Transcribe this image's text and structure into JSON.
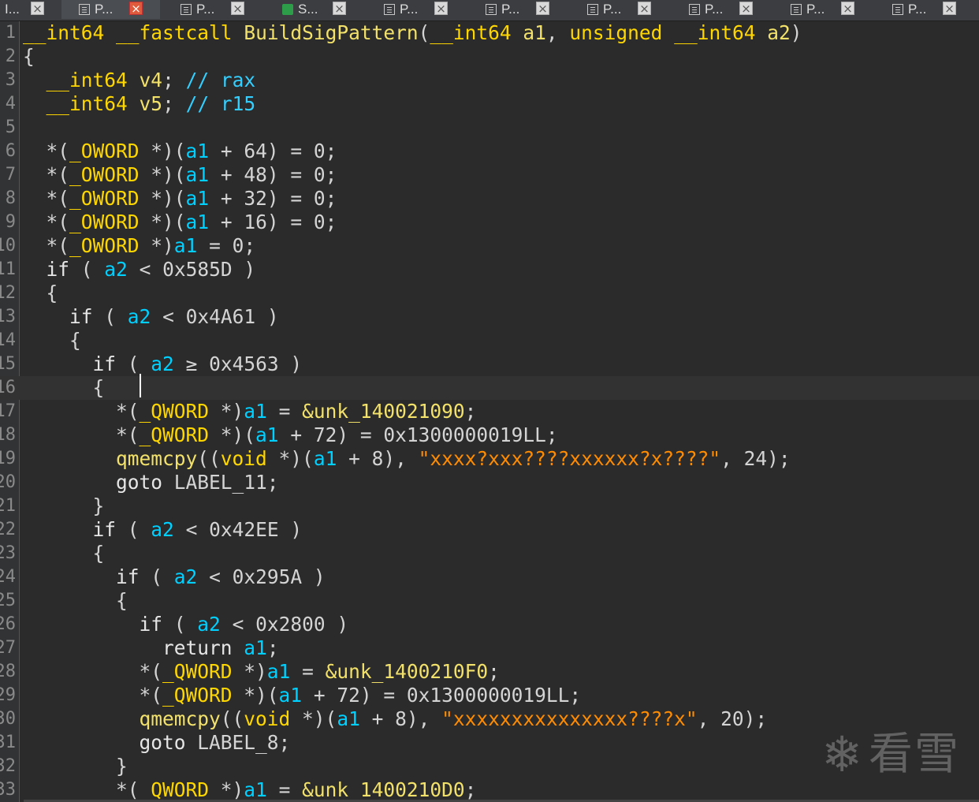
{
  "tabs": [
    {
      "label": "I...",
      "icon": "none",
      "active": false
    },
    {
      "label": "P...",
      "icon": "pseudocode-icon",
      "active": true
    },
    {
      "label": "P...",
      "icon": "pseudocode-icon",
      "active": false
    },
    {
      "label": "S...",
      "icon": "structures-icon",
      "active": false
    },
    {
      "label": "P...",
      "icon": "pseudocode-icon",
      "active": false
    },
    {
      "label": "P...",
      "icon": "pseudocode-icon",
      "active": false
    },
    {
      "label": "P...",
      "icon": "pseudocode-icon",
      "active": false
    },
    {
      "label": "P...",
      "icon": "pseudocode-icon",
      "active": false
    },
    {
      "label": "P...",
      "icon": "pseudocode-icon",
      "active": false
    },
    {
      "label": "P...",
      "icon": "pseudocode-icon",
      "active": false
    }
  ],
  "close_glyph": "×",
  "lines": [
    {
      "n": "1",
      "t": [
        [
          "ty",
          "__int64"
        ],
        [
          "pn",
          " "
        ],
        [
          "ty",
          "__fastcall"
        ],
        [
          "pn",
          " "
        ],
        [
          "fn",
          "BuildSigPattern"
        ],
        [
          "pn",
          "("
        ],
        [
          "ty",
          "__int64"
        ],
        [
          "pn",
          " "
        ],
        [
          "fn",
          "a1"
        ],
        [
          "pn",
          ", "
        ],
        [
          "ty",
          "unsigned"
        ],
        [
          "pn",
          " "
        ],
        [
          "ty",
          "__int64"
        ],
        [
          "pn",
          " "
        ],
        [
          "fn",
          "a2"
        ],
        [
          "pn",
          ")"
        ]
      ]
    },
    {
      "n": "2",
      "t": [
        [
          "pn",
          "{"
        ]
      ]
    },
    {
      "n": "3",
      "t": [
        [
          "pn",
          "  "
        ],
        [
          "ty",
          "__int64"
        ],
        [
          "pn",
          " "
        ],
        [
          "fn",
          "v4"
        ],
        [
          "pn",
          "; "
        ],
        [
          "cm",
          "// rax"
        ]
      ]
    },
    {
      "n": "4",
      "t": [
        [
          "pn",
          "  "
        ],
        [
          "ty",
          "__int64"
        ],
        [
          "pn",
          " "
        ],
        [
          "fn",
          "v5"
        ],
        [
          "pn",
          "; "
        ],
        [
          "cm",
          "// r15"
        ]
      ]
    },
    {
      "n": "5",
      "t": []
    },
    {
      "n": "6",
      "t": [
        [
          "pn",
          "  *("
        ],
        [
          "ty",
          "_OWORD"
        ],
        [
          "pn",
          " *)("
        ],
        [
          "vr",
          "a1"
        ],
        [
          "pn",
          " + 64) = 0;"
        ]
      ]
    },
    {
      "n": "7",
      "t": [
        [
          "pn",
          "  *("
        ],
        [
          "ty",
          "_OWORD"
        ],
        [
          "pn",
          " *)("
        ],
        [
          "vr",
          "a1"
        ],
        [
          "pn",
          " + 48) = 0;"
        ]
      ]
    },
    {
      "n": "8",
      "t": [
        [
          "pn",
          "  *("
        ],
        [
          "ty",
          "_OWORD"
        ],
        [
          "pn",
          " *)("
        ],
        [
          "vr",
          "a1"
        ],
        [
          "pn",
          " + 32) = 0;"
        ]
      ]
    },
    {
      "n": "9",
      "t": [
        [
          "pn",
          "  *("
        ],
        [
          "ty",
          "_OWORD"
        ],
        [
          "pn",
          " *)("
        ],
        [
          "vr",
          "a1"
        ],
        [
          "pn",
          " + 16) = 0;"
        ]
      ]
    },
    {
      "n": "10",
      "t": [
        [
          "pn",
          "  *("
        ],
        [
          "ty",
          "_OWORD"
        ],
        [
          "pn",
          " *)"
        ],
        [
          "vr",
          "a1"
        ],
        [
          "pn",
          " = 0;"
        ]
      ]
    },
    {
      "n": "11",
      "t": [
        [
          "pn",
          "  "
        ],
        [
          "kw",
          "if"
        ],
        [
          "pn",
          " ( "
        ],
        [
          "vr",
          "a2"
        ],
        [
          "pn",
          " < 0x585D )"
        ]
      ]
    },
    {
      "n": "12",
      "t": [
        [
          "pn",
          "  {"
        ]
      ]
    },
    {
      "n": "13",
      "t": [
        [
          "pn",
          "    "
        ],
        [
          "kw",
          "if"
        ],
        [
          "pn",
          " ( "
        ],
        [
          "vr",
          "a2"
        ],
        [
          "pn",
          " < 0x4A61 )"
        ]
      ]
    },
    {
      "n": "14",
      "t": [
        [
          "pn",
          "    {"
        ]
      ]
    },
    {
      "n": "15",
      "t": [
        [
          "pn",
          "      "
        ],
        [
          "kw",
          "if"
        ],
        [
          "pn",
          " ( "
        ],
        [
          "vr",
          "a2"
        ],
        [
          "pn",
          " ≥ 0x4563 )"
        ]
      ]
    },
    {
      "n": "16",
      "t": [
        [
          "pn",
          "      {"
        ]
      ],
      "current": true
    },
    {
      "n": "17",
      "t": [
        [
          "pn",
          "        *("
        ],
        [
          "ty",
          "_QWORD"
        ],
        [
          "pn",
          " *)"
        ],
        [
          "vr",
          "a1"
        ],
        [
          "pn",
          " = "
        ],
        [
          "fn",
          "&unk_140021090"
        ],
        [
          "pn",
          ";"
        ]
      ]
    },
    {
      "n": "18",
      "t": [
        [
          "pn",
          "        *("
        ],
        [
          "ty",
          "_QWORD"
        ],
        [
          "pn",
          " *)("
        ],
        [
          "vr",
          "a1"
        ],
        [
          "pn",
          " + 72) = 0x1300000019LL;"
        ]
      ]
    },
    {
      "n": "19",
      "t": [
        [
          "fn",
          "        qmemcpy"
        ],
        [
          "pn",
          "(("
        ],
        [
          "ty",
          "void"
        ],
        [
          "pn",
          " *)("
        ],
        [
          "vr",
          "a1"
        ],
        [
          "pn",
          " + 8), "
        ],
        [
          "st",
          "\"xxxx?xxx????xxxxxx?x????\""
        ],
        [
          "pn",
          ", 24);"
        ]
      ]
    },
    {
      "n": "20",
      "t": [
        [
          "pn",
          "        "
        ],
        [
          "kw",
          "goto"
        ],
        [
          "pn",
          " LABEL_11;"
        ]
      ]
    },
    {
      "n": "21",
      "t": [
        [
          "pn",
          "      }"
        ]
      ]
    },
    {
      "n": "22",
      "t": [
        [
          "pn",
          "      "
        ],
        [
          "kw",
          "if"
        ],
        [
          "pn",
          " ( "
        ],
        [
          "vr",
          "a2"
        ],
        [
          "pn",
          " < 0x42EE )"
        ]
      ]
    },
    {
      "n": "23",
      "t": [
        [
          "pn",
          "      {"
        ]
      ]
    },
    {
      "n": "24",
      "t": [
        [
          "pn",
          "        "
        ],
        [
          "kw",
          "if"
        ],
        [
          "pn",
          " ( "
        ],
        [
          "vr",
          "a2"
        ],
        [
          "pn",
          " < 0x295A )"
        ]
      ]
    },
    {
      "n": "25",
      "t": [
        [
          "pn",
          "        {"
        ]
      ]
    },
    {
      "n": "26",
      "t": [
        [
          "pn",
          "          "
        ],
        [
          "kw",
          "if"
        ],
        [
          "pn",
          " ( "
        ],
        [
          "vr",
          "a2"
        ],
        [
          "pn",
          " < 0x2800 )"
        ]
      ]
    },
    {
      "n": "27",
      "t": [
        [
          "pn",
          "            "
        ],
        [
          "kw",
          "return"
        ],
        [
          "pn",
          " "
        ],
        [
          "vr",
          "a1"
        ],
        [
          "pn",
          ";"
        ]
      ]
    },
    {
      "n": "28",
      "t": [
        [
          "pn",
          "          *("
        ],
        [
          "ty",
          "_QWORD"
        ],
        [
          "pn",
          " *)"
        ],
        [
          "vr",
          "a1"
        ],
        [
          "pn",
          " = "
        ],
        [
          "fn",
          "&unk_1400210F0"
        ],
        [
          "pn",
          ";"
        ]
      ]
    },
    {
      "n": "29",
      "t": [
        [
          "pn",
          "          *("
        ],
        [
          "ty",
          "_QWORD"
        ],
        [
          "pn",
          " *)("
        ],
        [
          "vr",
          "a1"
        ],
        [
          "pn",
          " + 72) = 0x1300000019LL;"
        ]
      ]
    },
    {
      "n": "30",
      "t": [
        [
          "fn",
          "          qmemcpy"
        ],
        [
          "pn",
          "(("
        ],
        [
          "ty",
          "void"
        ],
        [
          "pn",
          " *)("
        ],
        [
          "vr",
          "a1"
        ],
        [
          "pn",
          " + 8), "
        ],
        [
          "st",
          "\"xxxxxxxxxxxxxxx????x\""
        ],
        [
          "pn",
          ", 20);"
        ]
      ]
    },
    {
      "n": "31",
      "t": [
        [
          "pn",
          "          "
        ],
        [
          "kw",
          "goto"
        ],
        [
          "pn",
          " LABEL_8;"
        ]
      ]
    },
    {
      "n": "32",
      "t": [
        [
          "pn",
          "        }"
        ]
      ]
    },
    {
      "n": "33",
      "t": [
        [
          "pn",
          "        *("
        ],
        [
          "ty",
          "_QWORD"
        ],
        [
          "pn",
          " *)"
        ],
        [
          "vr",
          "a1"
        ],
        [
          "pn",
          " = "
        ],
        [
          "fn",
          "&unk_1400210D0"
        ],
        [
          "pn",
          ";"
        ]
      ]
    }
  ],
  "watermark": {
    "text": "看雪",
    "icon": "snowflake-icon",
    "glyph": "❄"
  }
}
